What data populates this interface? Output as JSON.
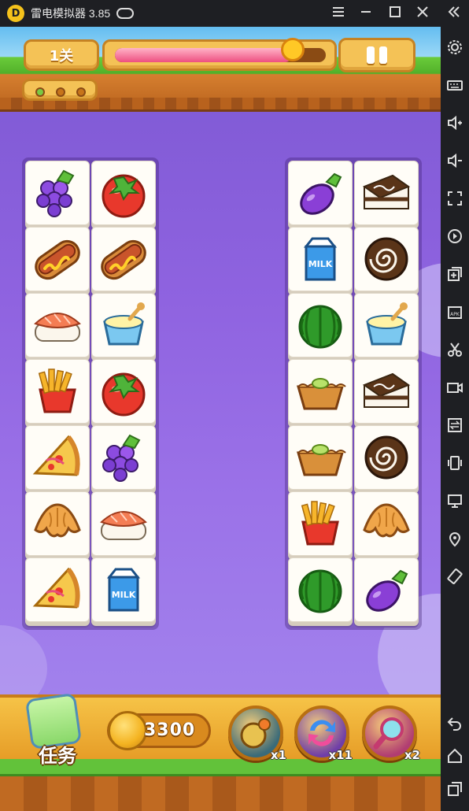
{
  "titlebar": {
    "app_name": "雷电模拟器 3.85",
    "logo_glyph": "D"
  },
  "sidebar": {
    "icons": [
      "settings-gear-icon",
      "keyboard-icon",
      "volume-up-icon",
      "volume-down-icon",
      "fullscreen-icon",
      "screen-record-icon",
      "multi-instance-icon",
      "apk-install-icon",
      "screenshot-scissors-icon",
      "video-record-icon",
      "sync-icon",
      "shake-icon",
      "display-icon",
      "location-icon",
      "rotate-icon",
      "back-icon",
      "home-icon",
      "recent-apps-icon"
    ]
  },
  "hud": {
    "level": "1关",
    "progress": 0.84
  },
  "board": {
    "left": [
      [
        "grape",
        "tomato"
      ],
      [
        "hotdog",
        "hotdog"
      ],
      [
        "sushi",
        "pudding"
      ],
      [
        "fries",
        "tomato"
      ],
      [
        "pizza",
        "grape"
      ],
      [
        "croissant",
        "sushi"
      ],
      [
        "pizza",
        "milk"
      ]
    ],
    "right": [
      [
        "eggplant",
        "cake"
      ],
      [
        "milk",
        "swissroll"
      ],
      [
        "watermelon",
        "pudding"
      ],
      [
        "tart",
        "cake"
      ],
      [
        "tart",
        "swissroll"
      ],
      [
        "fries",
        "croissant"
      ],
      [
        "watermelon",
        "eggplant"
      ]
    ]
  },
  "footer": {
    "task_label": "任务",
    "coins": "3300",
    "powerups": [
      {
        "name": "hint",
        "count": "x1",
        "color": "#3a6b79"
      },
      {
        "name": "shuffle",
        "count": "x11",
        "color": "#6f3ea8"
      },
      {
        "name": "magnifier",
        "count": "x2",
        "color": "#b13d72"
      }
    ]
  }
}
